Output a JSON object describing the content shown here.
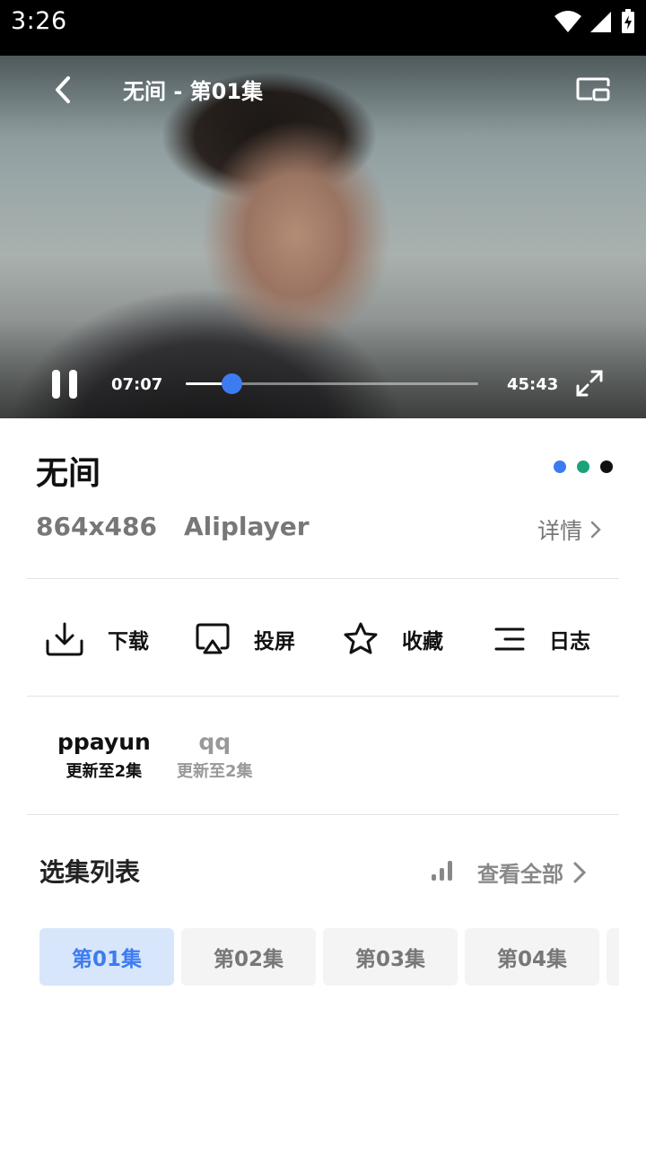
{
  "status_bar": {
    "time": "3:26"
  },
  "player": {
    "title": "无间 - 第01集",
    "current_time": "07:07",
    "total_time": "45:43",
    "progress": 0.156,
    "accent": "#3d7cf0"
  },
  "show": {
    "title": "无间",
    "resolution": "864x486",
    "player_name": "Aliplayer",
    "detail_label": "详情",
    "theme_dots": [
      "#3d7cf0",
      "#1aa37a",
      "#111111"
    ]
  },
  "actions": [
    {
      "label": "下载",
      "icon": "download-icon"
    },
    {
      "label": "投屏",
      "icon": "cast-icon"
    },
    {
      "label": "收藏",
      "icon": "star-icon"
    },
    {
      "label": "日志",
      "icon": "list-icon"
    }
  ],
  "sources": [
    {
      "name": "ppayun",
      "sub": "更新至2集",
      "active": true
    },
    {
      "name": "qq",
      "sub": "更新至2集",
      "active": false
    }
  ],
  "episodes": {
    "heading": "选集列表",
    "view_all": "查看全部",
    "items": [
      "第01集",
      "第02集",
      "第03集",
      "第04集"
    ],
    "active_index": 0
  }
}
